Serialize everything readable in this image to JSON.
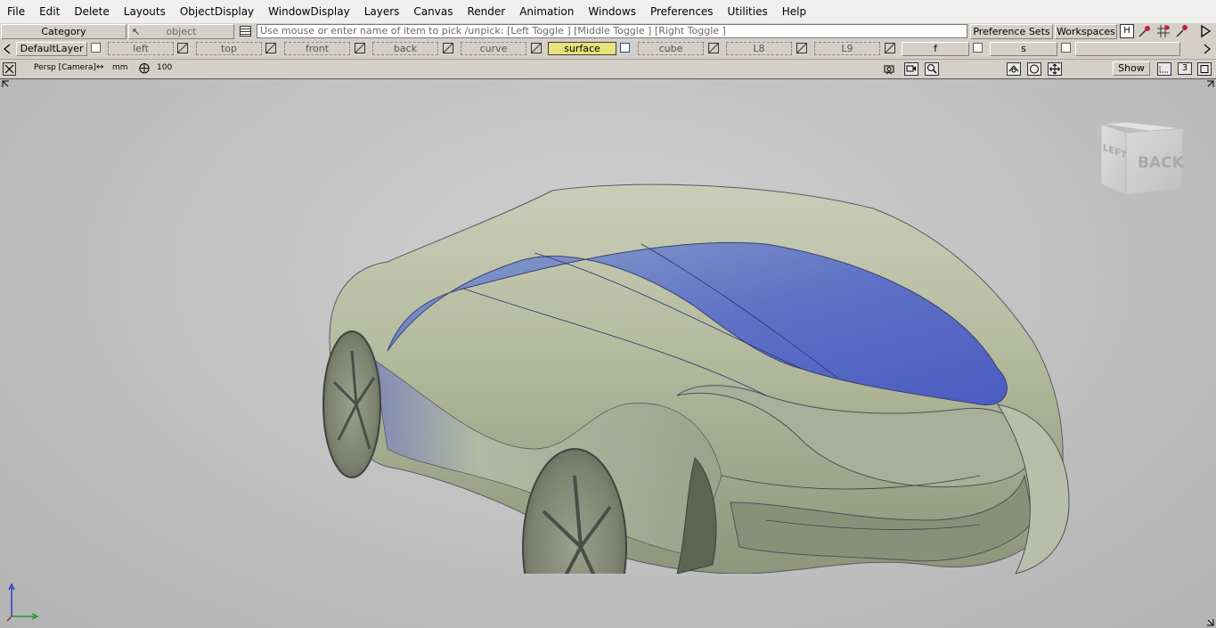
{
  "menu": [
    "File",
    "Edit",
    "Delete",
    "Layouts",
    "ObjectDisplay",
    "WindowDisplay",
    "Layers",
    "Canvas",
    "Render",
    "Animation",
    "Windows",
    "Preferences",
    "Utilities",
    "Help"
  ],
  "toolbar": {
    "category_label": "Category",
    "object_label": "object",
    "pick_prompt": "Use mouse or enter name of item to pick /unpick: [Left Toggle ] [Middle Toggle ] [Right Toggle ]",
    "preference_sets": "Preference Sets",
    "workspaces": "Workspaces"
  },
  "layers": {
    "default_layer": "DefaultLayer",
    "items": [
      "left",
      "top",
      "front",
      "back",
      "curve",
      "surface",
      "cube",
      "L8",
      "L9",
      "f",
      "s"
    ],
    "active": "surface",
    "active_color": "#e8e37a"
  },
  "viewport_header": {
    "camera_label": "Persp [Camera]",
    "units": "mm",
    "scale": "100",
    "show_button": "Show",
    "count": "3"
  },
  "viewcube": {
    "left_face": "LEFT",
    "back_face": "BACK"
  },
  "icons": [
    "close-icon",
    "pick-icon",
    "list-icon",
    "camera-icon",
    "record-icon",
    "zoom-icon",
    "tumble-icon",
    "ortho-icon",
    "move-icon",
    "grid-icon",
    "layer-visibility-icon",
    "arrow-right-icon",
    "arrow-left-icon"
  ]
}
